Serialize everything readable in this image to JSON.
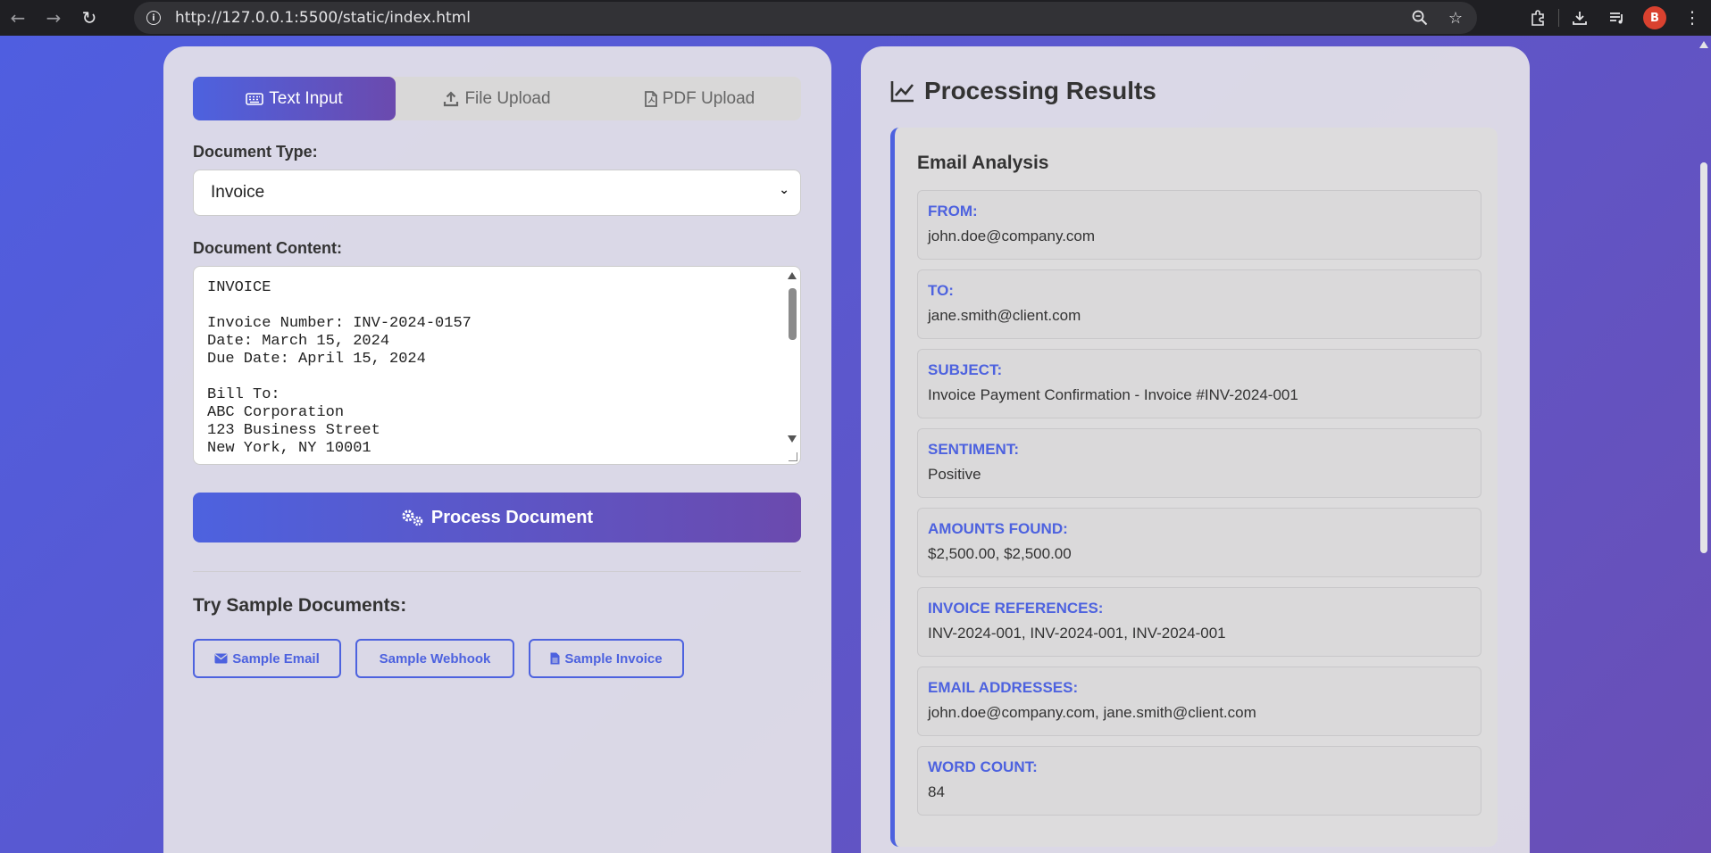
{
  "browser": {
    "url": "http://127.0.0.1:5500/static/index.html",
    "back_icon": "arrow-left-icon",
    "forward_icon": "arrow-right-icon",
    "reload_icon": "reload-icon",
    "avatar_initial": "B"
  },
  "input_panel": {
    "tabs": [
      {
        "label": "Text Input",
        "icon": "keyboard-icon"
      },
      {
        "label": "File Upload",
        "icon": "upload-icon"
      },
      {
        "label": "PDF Upload",
        "icon": "pdf-icon"
      }
    ],
    "document_type_label": "Document Type:",
    "document_type_value": "Invoice",
    "document_content_label": "Document Content:",
    "document_content": "INVOICE\n\nInvoice Number: INV-2024-0157\nDate: March 15, 2024\nDue Date: April 15, 2024\n\nBill To:\nABC Corporation\n123 Business Street\nNew York, NY 10001",
    "process_button": "Process Document",
    "samples_title": "Try Sample Documents:",
    "samples": [
      {
        "label": "Sample Email",
        "icon": "envelope-icon"
      },
      {
        "label": "Sample Webhook",
        "icon": "webhook-icon"
      },
      {
        "label": "Sample Invoice",
        "icon": "file-icon"
      }
    ]
  },
  "results_panel": {
    "title": "Processing Results",
    "section_title": "Email Analysis",
    "fields": [
      {
        "label": "From:",
        "value": "john.doe@company.com"
      },
      {
        "label": "To:",
        "value": "jane.smith@client.com"
      },
      {
        "label": "Subject:",
        "value": "Invoice Payment Confirmation - Invoice #INV-2024-001"
      },
      {
        "label": "Sentiment:",
        "value": "Positive"
      },
      {
        "label": "Amounts Found:",
        "value": "$2,500.00, $2,500.00"
      },
      {
        "label": "Invoice References:",
        "value": "INV-2024-001, INV-2024-001, INV-2024-001"
      },
      {
        "label": "Email Addresses:",
        "value": "john.doe@company.com, jane.smith@client.com"
      },
      {
        "label": "Word Count:",
        "value": "84"
      }
    ]
  },
  "colors": {
    "accent": "#4d62df",
    "accent_end": "#6b4aae"
  }
}
